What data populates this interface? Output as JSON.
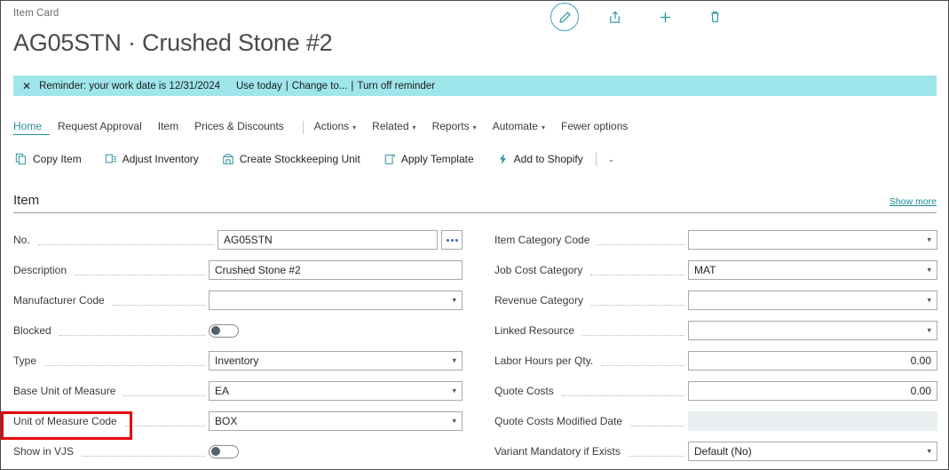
{
  "header": {
    "breadcrumb": "Item Card",
    "title": "AG05STN · Crushed Stone #2",
    "icons": [
      {
        "name": "edit-pencil-icon",
        "label": "Edit"
      },
      {
        "name": "share-icon",
        "label": "Share"
      },
      {
        "name": "plus-icon",
        "label": "New"
      },
      {
        "name": "trash-icon",
        "label": "Delete"
      }
    ]
  },
  "reminder": {
    "close_label": "✕",
    "text": "Reminder: your work date is 12/31/2024",
    "link_use_today": "Use today",
    "sep": "|",
    "link_change_to": "Change to...",
    "link_turn_off": "Turn off reminder"
  },
  "tabs": [
    {
      "label": "Home",
      "active": true,
      "chevron": false
    },
    {
      "label": "Request Approval",
      "active": false,
      "chevron": false
    },
    {
      "label": "Item",
      "active": false,
      "chevron": false
    },
    {
      "label": "Prices & Discounts",
      "active": false,
      "chevron": false
    },
    {
      "label": "Actions",
      "active": false,
      "chevron": true
    },
    {
      "label": "Related",
      "active": false,
      "chevron": true
    },
    {
      "label": "Reports",
      "active": false,
      "chevron": true
    },
    {
      "label": "Automate",
      "active": false,
      "chevron": true
    },
    {
      "label": "Fewer options",
      "active": false,
      "chevron": false
    }
  ],
  "ribbon": {
    "actions": [
      {
        "label": "Copy Item",
        "icon": "copy-item-icon"
      },
      {
        "label": "Adjust Inventory",
        "icon": "adjust-inventory-icon"
      },
      {
        "label": "Create Stockkeeping Unit",
        "icon": "create-stockkeeping-unit-icon"
      },
      {
        "label": "Apply Template",
        "icon": "apply-template-icon"
      },
      {
        "label": "Add to Shopify",
        "icon": "shopify-icon"
      }
    ],
    "overflow_chevron": "⌄"
  },
  "section": {
    "title": "Item",
    "show_more": "Show more"
  },
  "fields_left": [
    {
      "label": "No.",
      "value": "AG05STN",
      "type": "text",
      "assist": true
    },
    {
      "label": "Description",
      "value": "Crushed Stone #2",
      "type": "text",
      "assist": false
    },
    {
      "label": "Manufacturer Code",
      "value": "",
      "type": "dropdown"
    },
    {
      "label": "Blocked",
      "value": "",
      "type": "toggle",
      "toggle_state": "off"
    },
    {
      "label": "Type",
      "value": "Inventory",
      "type": "dropdown"
    },
    {
      "label": "Base Unit of Measure",
      "value": "EA",
      "type": "dropdown"
    },
    {
      "label": "Unit of Measure Code",
      "value": "BOX",
      "type": "dropdown",
      "highlighted": true
    },
    {
      "label": "Show in VJS",
      "value": "",
      "type": "toggle",
      "toggle_state": "off"
    }
  ],
  "fields_right": [
    {
      "label": "Item Category Code",
      "value": "",
      "type": "dropdown"
    },
    {
      "label": "Job Cost Category",
      "value": "MAT",
      "type": "dropdown"
    },
    {
      "label": "Revenue Category",
      "value": "",
      "type": "dropdown"
    },
    {
      "label": "Linked Resource",
      "value": "",
      "type": "dropdown"
    },
    {
      "label": "Labor Hours per Qty.",
      "value": "0.00",
      "type": "number"
    },
    {
      "label": "Quote Costs",
      "value": "0.00",
      "type": "number"
    },
    {
      "label": "Quote Costs Modified Date",
      "value": "",
      "type": "disabled"
    },
    {
      "label": "Variant Mandatory if Exists",
      "value": "Default (No)",
      "type": "dropdown"
    }
  ],
  "colors": {
    "accent_teal": "#2a8f9e",
    "link_teal": "#1b8a9c",
    "reminder_bg": "#9fe6ec",
    "annotation_red": "#e3000b"
  },
  "annotation": {
    "target": "Unit of Measure Code"
  }
}
